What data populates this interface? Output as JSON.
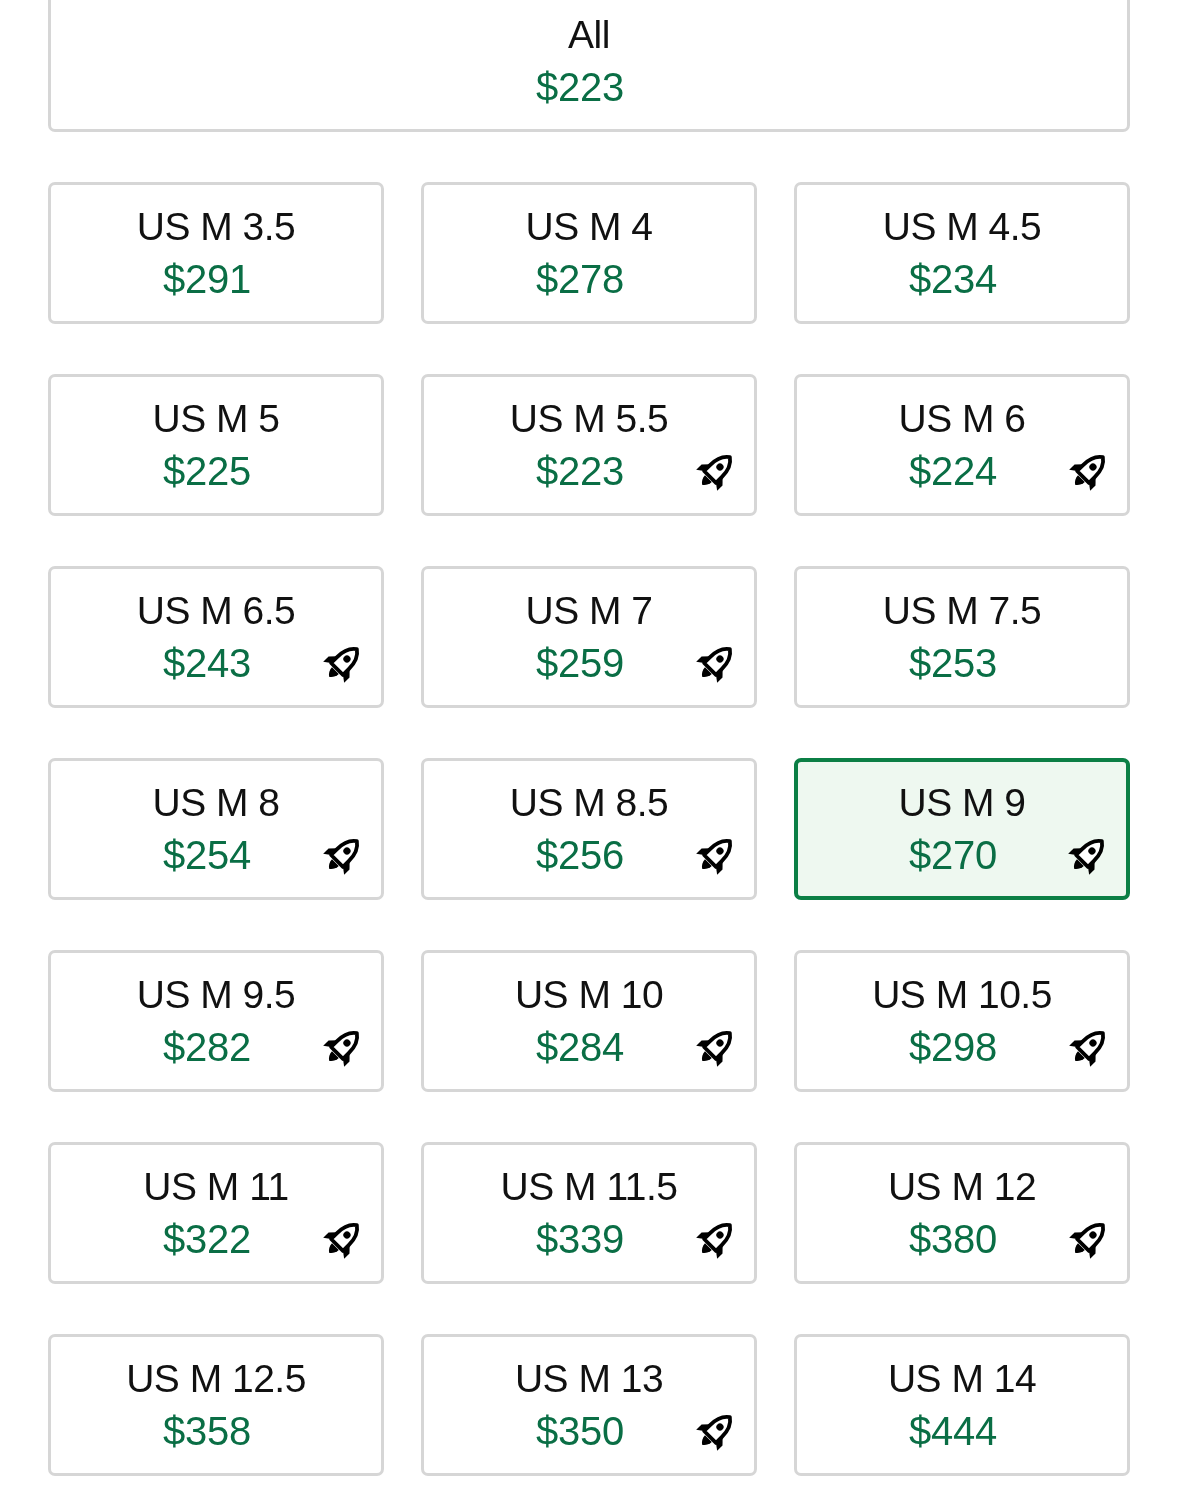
{
  "all": {
    "label": "All",
    "price": "$223",
    "selected": false
  },
  "sizes": [
    {
      "label": "US M 3.5",
      "price": "$291",
      "express": false,
      "selected": false
    },
    {
      "label": "US M 4",
      "price": "$278",
      "express": false,
      "selected": false
    },
    {
      "label": "US M 4.5",
      "price": "$234",
      "express": false,
      "selected": false
    },
    {
      "label": "US M 5",
      "price": "$225",
      "express": false,
      "selected": false
    },
    {
      "label": "US M 5.5",
      "price": "$223",
      "express": true,
      "selected": false
    },
    {
      "label": "US M 6",
      "price": "$224",
      "express": true,
      "selected": false
    },
    {
      "label": "US M 6.5",
      "price": "$243",
      "express": true,
      "selected": false
    },
    {
      "label": "US M 7",
      "price": "$259",
      "express": true,
      "selected": false
    },
    {
      "label": "US M 7.5",
      "price": "$253",
      "express": false,
      "selected": false
    },
    {
      "label": "US M 8",
      "price": "$254",
      "express": true,
      "selected": false
    },
    {
      "label": "US M 8.5",
      "price": "$256",
      "express": true,
      "selected": false
    },
    {
      "label": "US M 9",
      "price": "$270",
      "express": true,
      "selected": true
    },
    {
      "label": "US M 9.5",
      "price": "$282",
      "express": true,
      "selected": false
    },
    {
      "label": "US M 10",
      "price": "$284",
      "express": true,
      "selected": false
    },
    {
      "label": "US M 10.5",
      "price": "$298",
      "express": true,
      "selected": false
    },
    {
      "label": "US M 11",
      "price": "$322",
      "express": true,
      "selected": false
    },
    {
      "label": "US M 11.5",
      "price": "$339",
      "express": true,
      "selected": false
    },
    {
      "label": "US M 12",
      "price": "$380",
      "express": true,
      "selected": false
    },
    {
      "label": "US M 12.5",
      "price": "$358",
      "express": false,
      "selected": false
    },
    {
      "label": "US M 13",
      "price": "$350",
      "express": true,
      "selected": false
    },
    {
      "label": "US M 14",
      "price": "$444",
      "express": false,
      "selected": false
    }
  ]
}
